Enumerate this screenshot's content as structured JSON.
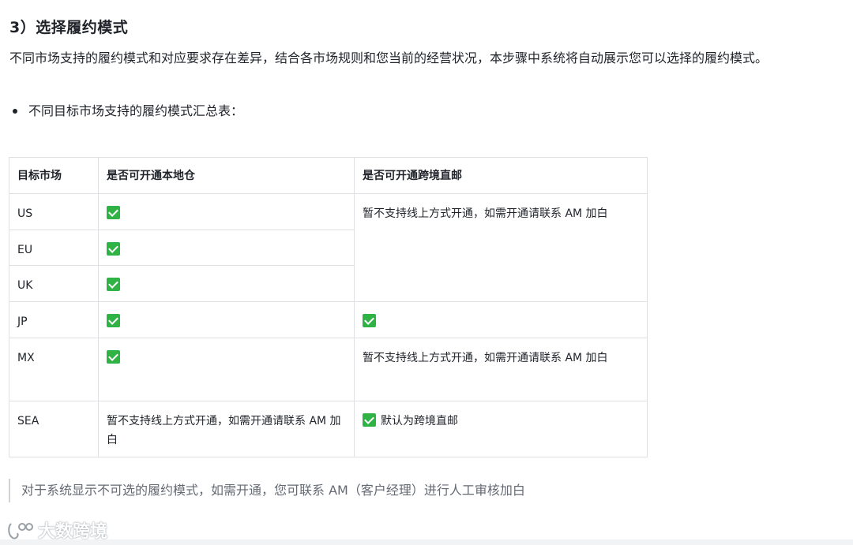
{
  "section": {
    "heading": "3）选择履约模式",
    "paragraph": "不同市场支持的履约模式和对应要求存在差异，结合各市场规则和您当前的经营状况，本步骤中系统将自动展示您可以选择的履约模式。",
    "bullet": "不同目标市场支持的履约模式汇总表："
  },
  "table": {
    "headers": [
      "目标市场",
      "是否可开通本地仓",
      "是否可开通跨境直邮"
    ],
    "rows": {
      "us": {
        "market": "US"
      },
      "eu": {
        "market": "EU"
      },
      "uk": {
        "market": "UK"
      },
      "jp": {
        "market": "JP"
      },
      "mx": {
        "market": "MX",
        "crossborder": "暂不支持线上方式开通，如需开通请联系 AM 加白"
      },
      "sea": {
        "market": "SEA",
        "local": "暂不支持线上方式开通，如需开通请联系 AM 加白",
        "crossborder": "默认为跨境直邮"
      }
    },
    "merged_crossborder_note": "暂不支持线上方式开通，如需开通请联系 AM 加白",
    "check_icon": "check-box-icon",
    "check_color": "#2fb344"
  },
  "quote": "对于系统显示不可选的履约模式，如需开通，您可联系 AM（客户经理）进行人工审核加白",
  "watermark": {
    "text": "大数跨境"
  }
}
